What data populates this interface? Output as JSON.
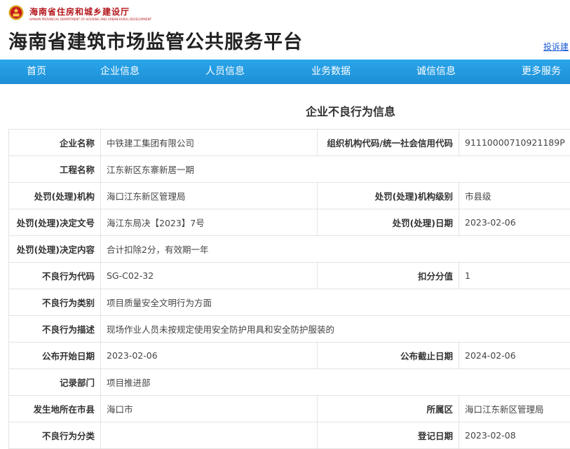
{
  "header": {
    "dept_name": "海南省住房和城乡建设厅",
    "dept_name_en": "HAINAN PROVINCIAL DEPARTMENT OF HOUSING AND URBAN-RURAL DEVELOPMENT",
    "site_title": "海南省建筑市场监管公共服务平台",
    "complaint_link": "投诉建",
    "emblem_icon": "national-emblem-icon",
    "brand_color": "#b4151b"
  },
  "nav": {
    "items": [
      "首页",
      "企业信息",
      "人员信息",
      "业务数据",
      "诚信信息",
      "更多服务"
    ],
    "color": "#1d8fd6"
  },
  "page": {
    "heading": "企业不良行为信息"
  },
  "details": {
    "company_name_label": "企业名称",
    "company_name": "中铁建工集团有限公司",
    "org_code_label": "组织机构代码/统一社会信用代码",
    "org_code": "91110000710921189P",
    "project_name_label": "工程名称",
    "project_name": "江东新区东寨新居一期",
    "authority_label": "处罚(处理)机构",
    "authority": "海口江东新区管理局",
    "authority_level_label": "处罚(处理)机构级别",
    "authority_level": "市县级",
    "decision_no_label": "处罚(处理)决定文号",
    "decision_no": "海江东局决【2023】7号",
    "decision_date_label": "处罚(处理)日期",
    "decision_date": "2023-02-06",
    "decision_content_label": "处罚(处理)决定内容",
    "decision_content": "合计扣除2分，有效期一年",
    "behavior_code_label": "不良行为代码",
    "behavior_code": "SG-C02-32",
    "points_label": "扣分分值",
    "points": "1",
    "behavior_category_label": "不良行为类别",
    "behavior_category": "项目质量安全文明行为方面",
    "behavior_desc_label": "不良行为描述",
    "behavior_desc": "现场作业人员未按规定使用安全防护用具和安全防护服装的",
    "publish_start_label": "公布开始日期",
    "publish_start": "2023-02-06",
    "publish_end_label": "公布截止日期",
    "publish_end": "2024-02-06",
    "record_dept_label": "记录部门",
    "record_dept": "项目推进部",
    "city_label": "发生地所在市县",
    "city": "海口市",
    "district_label": "所属区",
    "district": "海口江东新区管理局",
    "behavior_class_label": "不良行为分类",
    "behavior_class": "",
    "register_date_label": "登记日期",
    "register_date": "2023-02-08"
  }
}
